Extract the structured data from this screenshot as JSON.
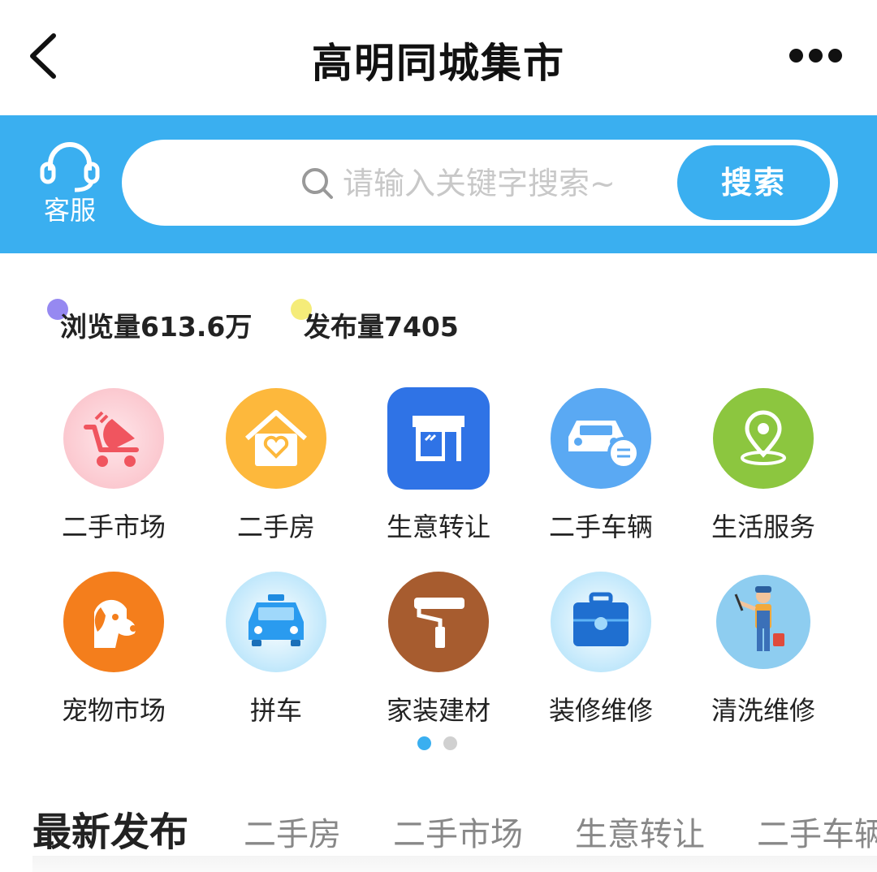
{
  "header": {
    "title": "高明同城集市",
    "back_icon": "chevron-left-icon",
    "more_icon": "more-dots-icon"
  },
  "search": {
    "service_label": "客服",
    "service_icon": "headset-icon",
    "placeholder": "请输入关键字搜索~",
    "button_label": "搜索",
    "accent_color": "#3aaff0"
  },
  "stats": {
    "views": "浏览量613.6万",
    "posts": "发布量7405",
    "views_dot_color": "#8b7cf0",
    "posts_dot_color": "#f4ea6a"
  },
  "categories": [
    {
      "label": "二手市场",
      "icon": "stroller-icon"
    },
    {
      "label": "二手房",
      "icon": "house-heart-icon"
    },
    {
      "label": "生意转让",
      "icon": "shop-icon"
    },
    {
      "label": "二手车辆",
      "icon": "car-icon"
    },
    {
      "label": "生活服务",
      "icon": "location-pin-icon"
    },
    {
      "label": "宠物市场",
      "icon": "dog-icon"
    },
    {
      "label": "拼车",
      "icon": "taxi-icon"
    },
    {
      "label": "家装建材",
      "icon": "paint-roller-icon"
    },
    {
      "label": "装修维修",
      "icon": "toolbox-icon"
    },
    {
      "label": "清洗维修",
      "icon": "cleaner-worker-icon"
    }
  ],
  "pager": {
    "active_page": 1,
    "total_pages": 2
  },
  "tabs": [
    {
      "label": "最新发布"
    },
    {
      "label": "二手房"
    },
    {
      "label": "二手市场"
    },
    {
      "label": "生意转让"
    },
    {
      "label": "二手车辆"
    }
  ]
}
